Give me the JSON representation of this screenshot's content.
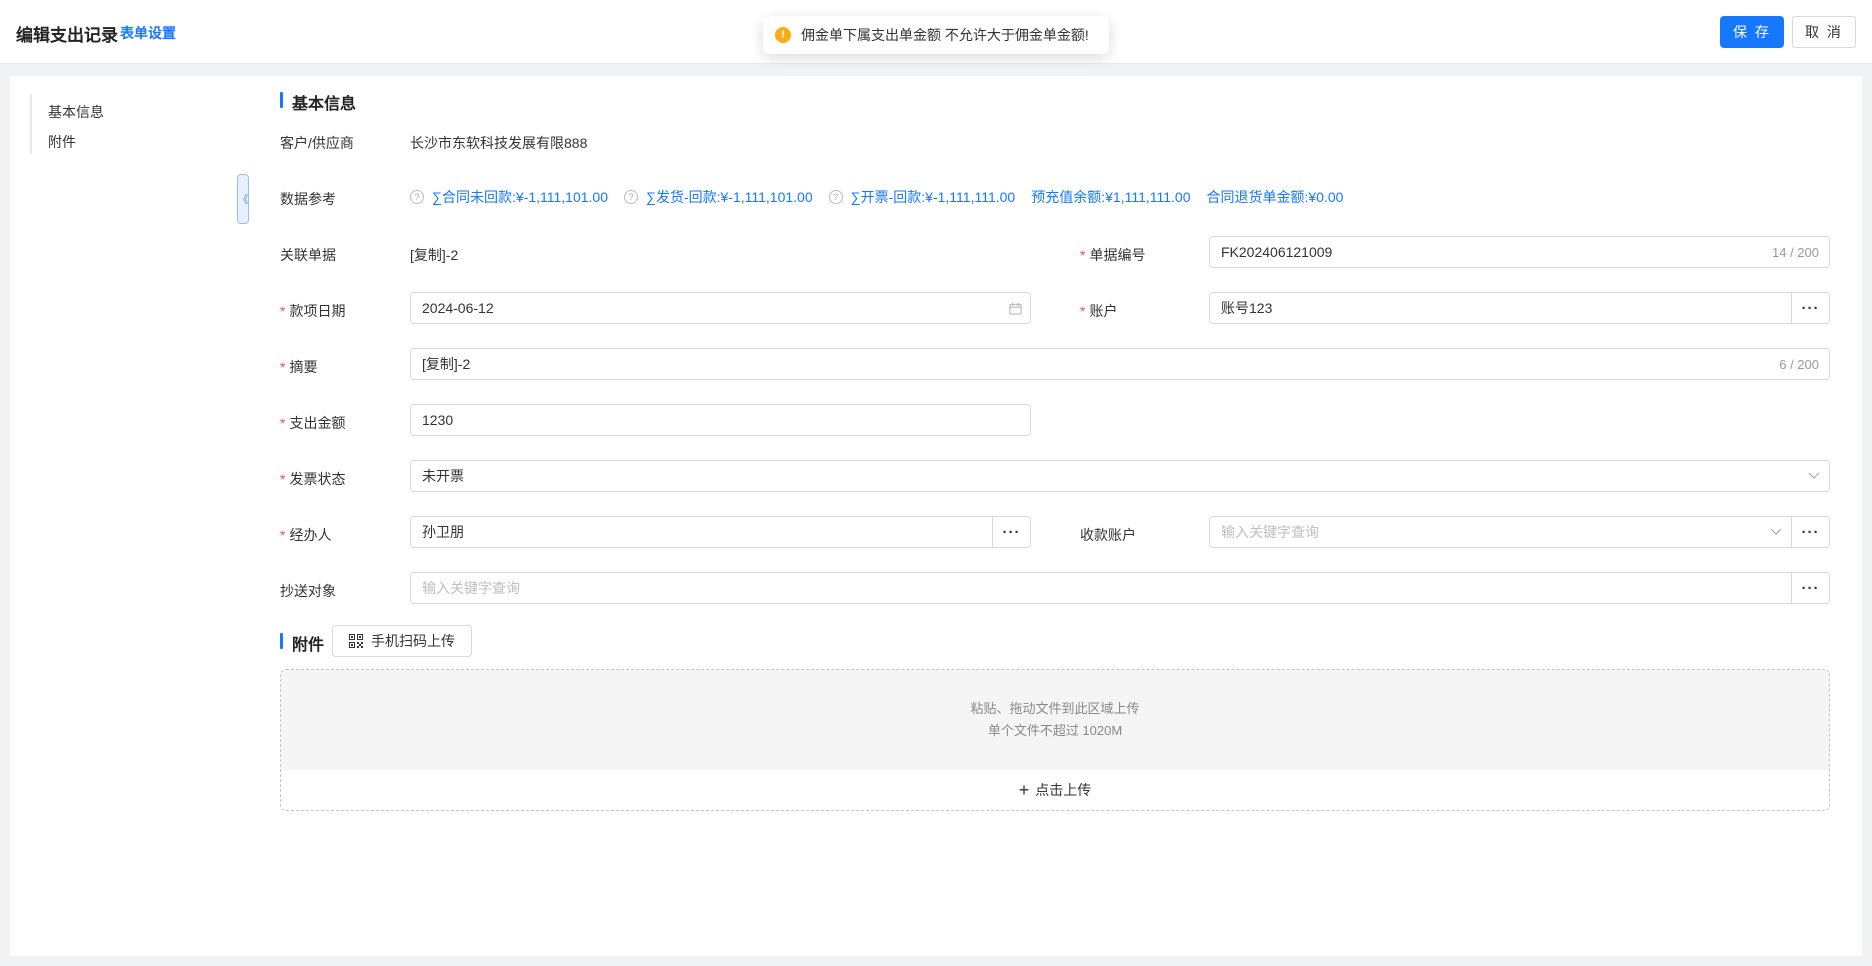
{
  "header": {
    "title": "编辑支出记录",
    "form_settings": "表单设置",
    "save_label": "保 存",
    "cancel_label": "取 消"
  },
  "toast": {
    "message": "佣金单下属支出单金额 不允许大于佣金单金额!"
  },
  "sidebar": {
    "items": [
      {
        "label": "基本信息"
      },
      {
        "label": "附件"
      }
    ]
  },
  "basic": {
    "section_title": "基本信息",
    "customer": {
      "label": "客户/供应商",
      "value": "长沙市东软科技发展有限888"
    },
    "data_ref": {
      "label": "数据参考",
      "items": [
        {
          "label": "∑合同未回款:¥-1,111,101.00"
        },
        {
          "label": "∑发货-回款:¥-1,111,101.00"
        },
        {
          "label": "∑开票-回款:¥-1,111,111.00"
        },
        {
          "label": "预充值余额:¥1,111,111.00"
        },
        {
          "label": "合同退货单金额:¥0.00"
        }
      ]
    },
    "related": {
      "label": "关联单据",
      "value": "[复制]-2"
    },
    "doc_no": {
      "label": "单据编号",
      "value": "FK202406121009",
      "count": "14 / 200"
    },
    "date": {
      "label": "款项日期",
      "value": "2024-06-12"
    },
    "account": {
      "label": "账户",
      "value": "账号123"
    },
    "summary": {
      "label": "摘要",
      "value": "[复制]-2",
      "count": "6 / 200"
    },
    "amount": {
      "label": "支出金额",
      "value": "1230"
    },
    "invoice": {
      "label": "发票状态",
      "value": "未开票"
    },
    "handler": {
      "label": "经办人",
      "value": "孙卫朋"
    },
    "payee": {
      "label": "收款账户",
      "placeholder": "输入关键字查询"
    },
    "cc": {
      "label": "抄送对象",
      "placeholder": "输入关键字查询"
    }
  },
  "attach": {
    "section_title": "附件",
    "qr_label": "手机扫码上传",
    "drop_line1": "粘贴、拖动文件到此区域上传",
    "drop_line2": "单个文件不超过 1020M",
    "click_label": "点击上传"
  },
  "colors": {
    "primary": "#1677ff",
    "required": "#ff4d4f",
    "warning": "#faad14"
  },
  "icons": [
    "warning-icon",
    "help-icon",
    "calendar-icon",
    "chevron-down-icon",
    "more-icon",
    "qrcode-icon",
    "plus-icon",
    "collapse-icon"
  ]
}
